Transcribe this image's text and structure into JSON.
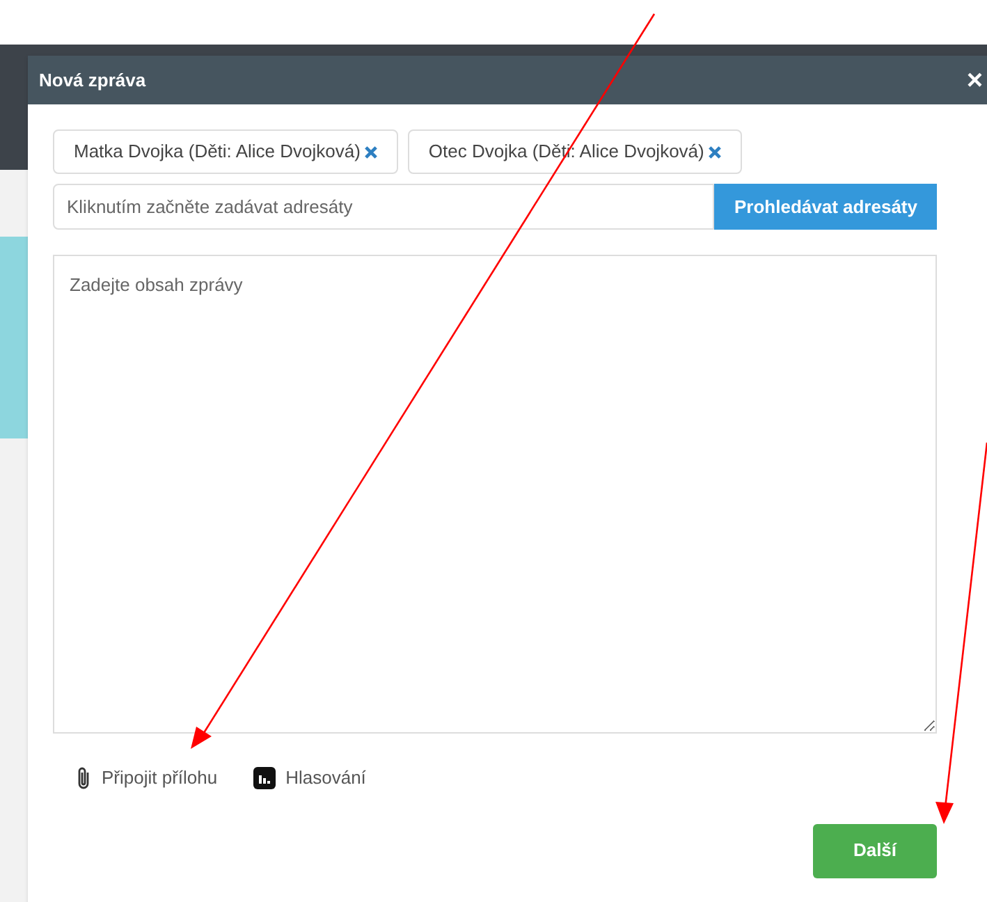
{
  "dialog": {
    "title": "Nová zpráva",
    "close": "×"
  },
  "recipients": [
    {
      "label": "Matka Dvojka (Děti: Alice Dvojková)"
    },
    {
      "label": "Otec Dvojka (Děti: Alice Dvojková)"
    }
  ],
  "recipient_field": {
    "placeholder": "Kliknutím začněte zadávat adresáty"
  },
  "search_button": "Prohledávat adresáty",
  "message_field": {
    "placeholder": "Zadejte obsah zprávy"
  },
  "actions": [
    {
      "kind": "attachment",
      "label": "Připojit přílohu"
    },
    {
      "kind": "poll",
      "label": "Hlasování"
    }
  ],
  "next_button": "Další"
}
